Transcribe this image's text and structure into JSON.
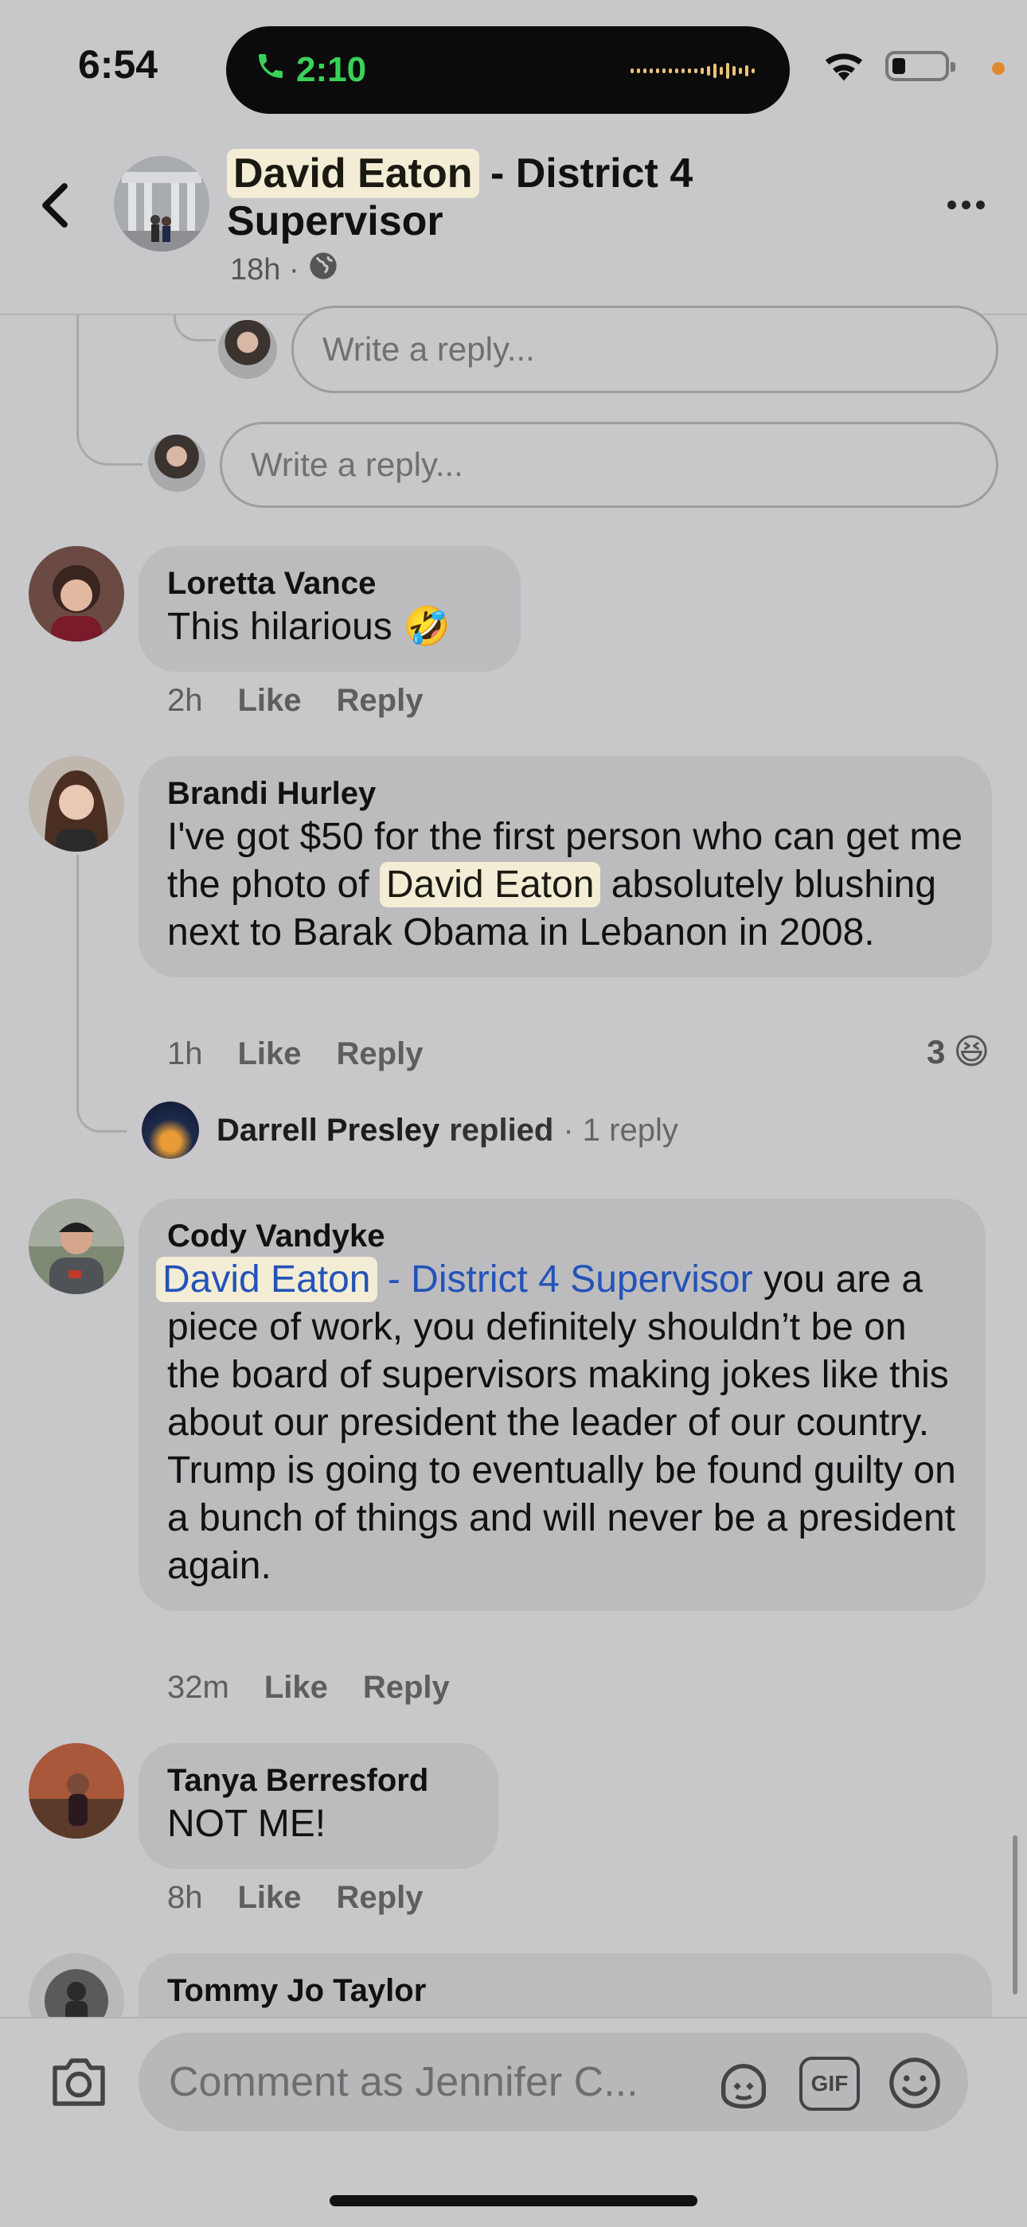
{
  "status_bar": {
    "time": "6:54",
    "call_duration": "2:10",
    "call_icon": "phone-icon",
    "icons": [
      "wifi-icon",
      "battery-icon"
    ]
  },
  "header": {
    "title_name": "David Eaton",
    "title_rest": " - District 4 Supervisor",
    "meta_time": "18h ·",
    "privacy_icon": "globe-icon",
    "back_icon": "chevron-left-icon",
    "more_icon": "more-icon"
  },
  "reply_inputs": {
    "placeholder": "Write a reply..."
  },
  "comments": [
    {
      "author": "Loretta Vance",
      "text": "This hilarious",
      "emoji": "🤣",
      "time": "2h",
      "like": "Like",
      "reply": "Reply"
    },
    {
      "author": "Brandi Hurley",
      "text_before": "I've got $50 for the first person who can get me the photo of",
      "mention": "David Eaton",
      "text_after": "absolutely blushing next to Barak Obama in Lebanon in 2008.",
      "time": "1h",
      "like": "Like",
      "reply": "Reply",
      "reaction_count": "3",
      "reaction_emoji": "😆",
      "replied_name": "Darrell Presley",
      "replied_text": "replied",
      "replied_count": "· 1 reply"
    },
    {
      "author": "Cody Vandyke",
      "mention_name": "David Eaton",
      "mention_rest": "- District 4 Supervisor",
      "text": "you are a piece of work, you definitely shouldn’t be on the board of supervisors making jokes like this about our president the leader of our country. Trump is going to eventually be found guilty on a bunch of things and will never be a president again.",
      "time": "32m",
      "like": "Like",
      "reply": "Reply"
    },
    {
      "author": "Tanya Berresford",
      "text": "NOT ME!",
      "time": "8h",
      "like": "Like",
      "reply": "Reply"
    },
    {
      "author": "Tommy Jo Taylor"
    }
  ],
  "composer": {
    "placeholder": "Comment as Jennifer C...",
    "icons": [
      "camera-icon",
      "avatar-sticker-icon",
      "gif-icon",
      "emoji-icon"
    ],
    "gif_label": "GIF"
  },
  "colors": {
    "background": "#c8c8ca",
    "bubble": "#bcbcbf",
    "link": "#2353b8",
    "highlight": "#f3edd6",
    "call_green": "#3ad15a"
  }
}
